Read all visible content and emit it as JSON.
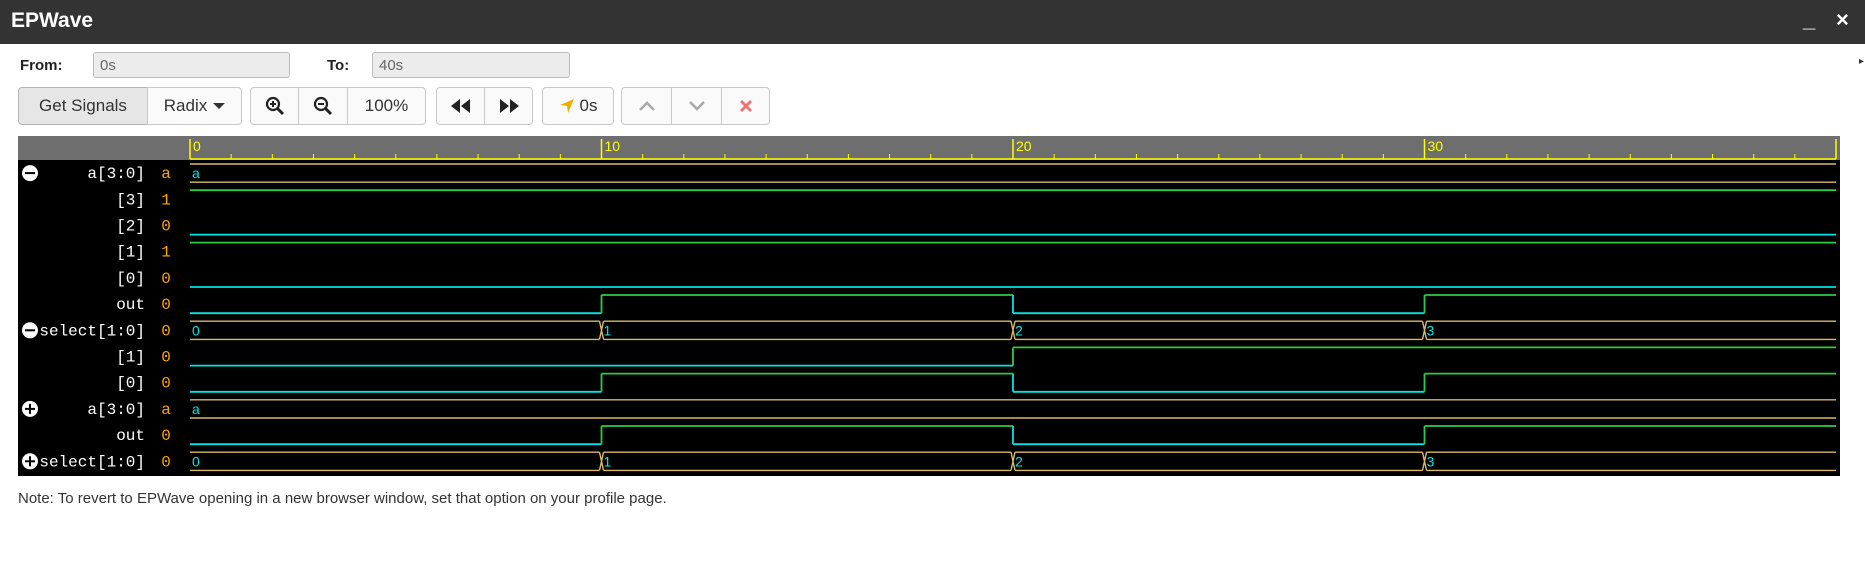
{
  "window": {
    "title": "EPWave",
    "minimize_label": "_",
    "close_label": "×"
  },
  "range": {
    "from_label": "From:",
    "from_value": "0s",
    "to_label": "To:",
    "to_value": "40s"
  },
  "toolbar": {
    "get_signals_label": "Get Signals",
    "radix_label": "Radix",
    "zoom_level": "100%",
    "cursor_time": "0s",
    "icons": [
      "zoom-in-icon",
      "zoom-out-icon",
      "rewind-icon",
      "fast-forward-icon",
      "cursor-marker-icon",
      "chevron-up-icon",
      "chevron-down-icon",
      "delete-icon"
    ]
  },
  "timeline": {
    "range_start": 0,
    "range_end": 40,
    "tick_labels": [
      "0",
      "10",
      "20",
      "30"
    ],
    "colors": {
      "ruler_bg": "#6e6e6e",
      "ruler_ticks": "#ffff00",
      "bus": "#d9b96a",
      "signal_high": "#2ecc40",
      "signal_low": "#00e5e5",
      "name": "#ffffff",
      "value": "#ffa500"
    }
  },
  "signals": [
    {
      "name": "a[3:0]",
      "value": "a",
      "kind": "bus",
      "group": "collapse",
      "segments": [
        {
          "t": 0,
          "label": "a"
        }
      ]
    },
    {
      "name": "[3]",
      "value": "1",
      "kind": "bit",
      "transitions": [
        [
          0,
          1
        ]
      ]
    },
    {
      "name": "[2]",
      "value": "0",
      "kind": "bit",
      "transitions": [
        [
          0,
          0
        ]
      ]
    },
    {
      "name": "[1]",
      "value": "1",
      "kind": "bit",
      "transitions": [
        [
          0,
          1
        ]
      ]
    },
    {
      "name": "[0]",
      "value": "0",
      "kind": "bit",
      "transitions": [
        [
          0,
          0
        ]
      ]
    },
    {
      "name": "out",
      "value": "0",
      "kind": "bit",
      "transitions": [
        [
          0,
          0
        ],
        [
          10,
          1
        ],
        [
          20,
          0
        ],
        [
          30,
          1
        ]
      ]
    },
    {
      "name": "select[1:0]",
      "value": "0",
      "kind": "bus",
      "group": "collapse",
      "segments": [
        {
          "t": 0,
          "label": "0"
        },
        {
          "t": 10,
          "label": "1"
        },
        {
          "t": 20,
          "label": "2"
        },
        {
          "t": 30,
          "label": "3"
        }
      ]
    },
    {
      "name": "[1]",
      "value": "0",
      "kind": "bit",
      "transitions": [
        [
          0,
          0
        ],
        [
          20,
          1
        ]
      ]
    },
    {
      "name": "[0]",
      "value": "0",
      "kind": "bit",
      "transitions": [
        [
          0,
          0
        ],
        [
          10,
          1
        ],
        [
          20,
          0
        ],
        [
          30,
          1
        ]
      ]
    },
    {
      "name": "a[3:0]",
      "value": "a",
      "kind": "bus",
      "group": "expand",
      "segments": [
        {
          "t": 0,
          "label": "a"
        }
      ]
    },
    {
      "name": "out",
      "value": "0",
      "kind": "bit",
      "transitions": [
        [
          0,
          0
        ],
        [
          10,
          1
        ],
        [
          20,
          0
        ],
        [
          30,
          1
        ]
      ]
    },
    {
      "name": "select[1:0]",
      "value": "0",
      "kind": "bus",
      "group": "expand",
      "segments": [
        {
          "t": 0,
          "label": "0"
        },
        {
          "t": 10,
          "label": "1"
        },
        {
          "t": 20,
          "label": "2"
        },
        {
          "t": 30,
          "label": "3"
        }
      ]
    }
  ],
  "note": "Note: To revert to EPWave opening in a new browser window, set that option on your profile page."
}
